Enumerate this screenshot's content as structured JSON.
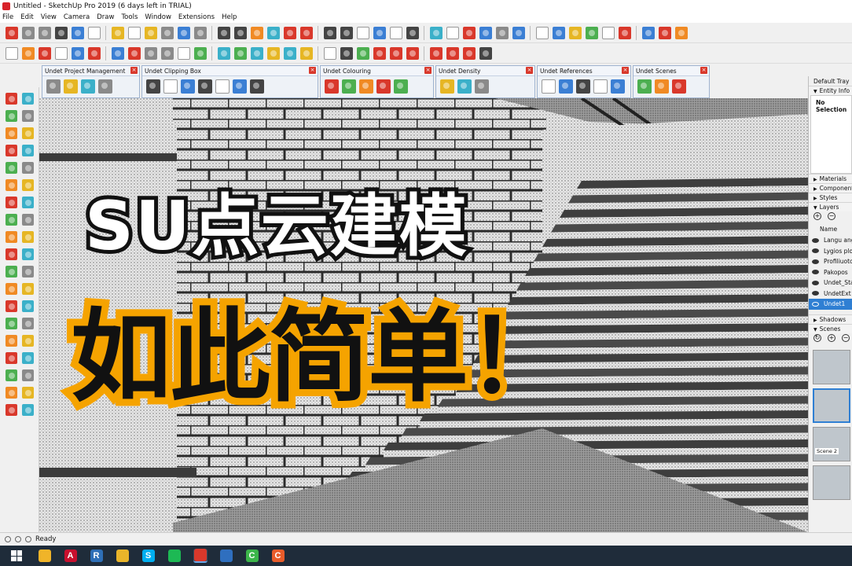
{
  "window": {
    "title": "Untitled - SketchUp Pro 2019 (6 days left in TRIAL)"
  },
  "menu": [
    "File",
    "Edit",
    "View",
    "Camera",
    "Draw",
    "Tools",
    "Window",
    "Extensions",
    "Help"
  ],
  "toolbars": {
    "row1": [
      "select-cursor-icon",
      "open-file-icon",
      "save-icon",
      "cut-icon",
      "copy-icon",
      "paste-icon",
      "erase-icon",
      "undo-icon",
      "redo-icon",
      "print-icon",
      "model-info-icon",
      "cube-icon",
      "cube-outline-icon",
      "section-icon",
      "box-icon",
      "material-icon",
      "paint-icon",
      "component-icon",
      "warehouse-icon",
      "home-icon",
      "house-front-icon",
      "house-top-icon",
      "house-side-icon",
      "perspective-icon",
      "download-icon",
      "move-icon",
      "push-pull-icon",
      "rotate-icon",
      "follow-me-icon",
      "scale-icon",
      "offset-icon",
      "tape-icon",
      "protractor-icon",
      "text-icon",
      "axes-icon",
      "dimension-icon",
      "layers-icon",
      "outliner-icon",
      "extension-icon"
    ],
    "row2": [
      "select-arrow-icon",
      "make-component-icon",
      "paint-bucket-icon",
      "eraser-icon",
      "line-icon",
      "pencil-icon",
      "arc-icon",
      "shape-icon",
      "push-pull2-icon",
      "move2-icon",
      "rotate2-icon",
      "scale2-icon",
      "tape2-icon",
      "text2-icon",
      "walk-icon",
      "orbit-icon",
      "pan-icon",
      "zoom-icon",
      "zoom-extents-icon",
      "section-plane-icon",
      "paint2-icon",
      "sandbox-icon",
      "look-around-icon",
      "position-camera-icon",
      "footprints-icon",
      "axes2-icon",
      "cube-view-icon",
      "home-view-icon"
    ]
  },
  "panels": [
    {
      "title": "Undet Project Management",
      "icons": [
        "folder-open-icon",
        "add-pointcloud-icon",
        "delete-pointcloud-icon",
        "settings-circle-icon"
      ]
    },
    {
      "title": "Undet Clipping Box",
      "icons": [
        "clip-box-icon",
        "clip-box-add-icon",
        "clip-box-remove-icon",
        "clip-box-invert-icon",
        "clip-box-hide-icon",
        "clip-box-section-icon",
        "clip-box-edit-icon"
      ]
    },
    {
      "title": "Undet Colouring",
      "icons": [
        "palette-icon",
        "palette-rgb-icon",
        "palette-intensity-icon",
        "palette-height-icon",
        "palette-class-icon"
      ]
    },
    {
      "title": "Undet Density",
      "icons": [
        "density-low-icon",
        "density-mid-icon",
        "density-high-icon"
      ]
    },
    {
      "title": "Undet References",
      "icons": [
        "ref-point-icon",
        "ref-line-icon",
        "ref-snap-icon",
        "ref-edge-icon",
        "ref-plane-icon"
      ]
    },
    {
      "title": "Undet Scenes",
      "icons": [
        "scene-add-icon",
        "scene-play-icon",
        "scene-forward-icon"
      ]
    }
  ],
  "headline": {
    "line1": "SU点云建模",
    "line2": "如此简单！"
  },
  "tray": {
    "title": "Default Tray",
    "entity_info_label": "Entity Info",
    "entity_info_value": "No Selection",
    "sections": [
      "Materials",
      "Components",
      "Styles"
    ],
    "layers_label": "Layers",
    "layers_header": "Name",
    "layers": [
      {
        "name": "Langu angos",
        "visible": true,
        "selected": false
      },
      {
        "name": "Lygios plokš",
        "visible": true,
        "selected": false
      },
      {
        "name": "Profiliuotos",
        "visible": true,
        "selected": false
      },
      {
        "name": "Pakopos",
        "visible": true,
        "selected": false
      },
      {
        "name": "Undet_Sta",
        "visible": true,
        "selected": false
      },
      {
        "name": "UndetExt",
        "visible": true,
        "selected": false
      },
      {
        "name": "Undet1",
        "visible": false,
        "selected": true
      }
    ],
    "shadows_label": "Shadows",
    "scenes_label": "Scenes",
    "scene_tag": "Scene 2"
  },
  "status": {
    "text": "Ready"
  },
  "taskbar": {
    "apps": [
      {
        "name": "file-explorer-icon",
        "letter": "",
        "color": "#f0b429",
        "active": false
      },
      {
        "name": "autocad-icon",
        "letter": "A",
        "color": "#c8102e",
        "active": false
      },
      {
        "name": "revit-icon",
        "letter": "R",
        "color": "#2e6fb7",
        "active": false
      },
      {
        "name": "chrome-icon",
        "letter": "",
        "color": "#e9b52a",
        "active": false
      },
      {
        "name": "skype-icon",
        "letter": "S",
        "color": "#00aff0",
        "active": false
      },
      {
        "name": "spotify-icon",
        "letter": "",
        "color": "#1db954",
        "active": false
      },
      {
        "name": "sketchup-icon",
        "letter": "",
        "color": "#d9382b",
        "active": true
      },
      {
        "name": "outlook-icon",
        "letter": "",
        "color": "#2f6fbf",
        "active": false
      },
      {
        "name": "camtasia-icon",
        "letter": "C",
        "color": "#3cb54a",
        "active": false
      },
      {
        "name": "camtasia-recorder-icon",
        "letter": "C",
        "color": "#e85c2a",
        "active": false
      }
    ]
  }
}
